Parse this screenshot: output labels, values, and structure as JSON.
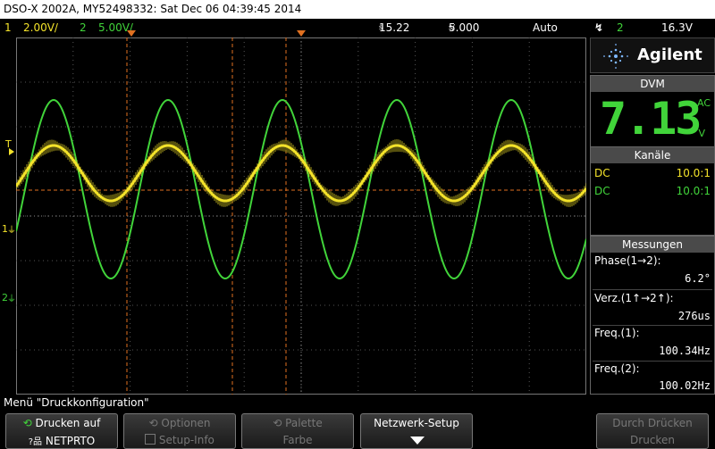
{
  "title": "DSO-X 2002A, MY52498332: Sat Dec 06 04:39:45 2014",
  "status": {
    "ch1_num": "1",
    "ch1_scale": "2.00V/",
    "ch2_num": "2",
    "ch2_scale": "5.00V/",
    "time_pos": "15.22",
    "time_pos_unit": "s",
    "time_scale": "5.000",
    "time_scale_unit": "s/",
    "trigger_mode": "Auto",
    "trigger_source": "2",
    "trigger_level": "16.3V"
  },
  "brand": "Agilent",
  "dvm": {
    "header": "DVM",
    "value": "7.13",
    "coupling": "AC",
    "unit": "V"
  },
  "channels": {
    "header": "Kanäle",
    "rows": [
      {
        "coupling": "DC",
        "ratio": "10.0:1",
        "color": "#f4e32a"
      },
      {
        "coupling": "DC",
        "ratio": "10.0:1",
        "color": "#41d43a"
      }
    ]
  },
  "measurements": {
    "header": "Messungen",
    "items": [
      {
        "label": "Phase(1→2):",
        "value": "6.2°"
      },
      {
        "label": "Verz.(1↑→2↑):",
        "value": "276us"
      },
      {
        "label": "Freq.(1):",
        "value": "100.34Hz"
      },
      {
        "label": "Freq.(2):",
        "value": "100.02Hz"
      }
    ]
  },
  "markers": {
    "trigger": "T",
    "ch1": "1",
    "ch2": "2"
  },
  "menu_title": "Menü \"Druckkonfiguration\"",
  "softkeys": {
    "k1_l1": "Drucken auf",
    "k1_l2": "NETPRTO",
    "k2_l1": "Optionen",
    "k2_l2": "Setup-Info",
    "k3_l1": "Palette",
    "k3_l2": "Farbe",
    "k4_l1": "Netzwerk-Setup",
    "k6_l1": "Durch Drücken",
    "k6_l2": "Drucken"
  },
  "waveforms": {
    "ch1": {
      "color": "#f4e32a",
      "amplitude_div": 0.62,
      "cycles": 5,
      "phase_deg": 0
    },
    "ch2": {
      "color": "#41d43a",
      "amplitude_div": 2.0,
      "cycles": 5,
      "phase_deg": 6.2
    }
  },
  "colors": {
    "ch1": "#f4e32a",
    "ch2": "#41d43a",
    "grid": "#555555",
    "trigger_line": "#e07020"
  }
}
